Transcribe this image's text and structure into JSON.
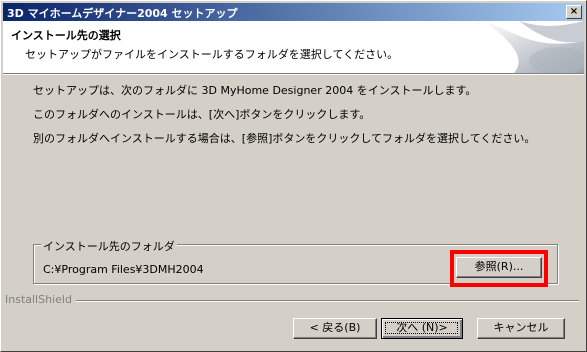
{
  "window": {
    "title": "3D マイホームデザイナー2004 セットアップ",
    "close_label": "×"
  },
  "header": {
    "title": "インストール先の選択",
    "subtitle": "セットアップがファイルをインストールするフォルダを選択してください。"
  },
  "body": {
    "line1": "セットアップは、次のフォルダに 3D MyHome Designer 2004 をインストールします。",
    "line2": "このフォルダへのインストールは、[次へ]ボタンをクリックします。",
    "line3": "別のフォルダへインストールする場合は、[参照]ボタンをクリックしてフォルダを選択してください。"
  },
  "destination": {
    "group_label": "インストール先のフォルダ",
    "path": "C:¥Program Files¥3DMH2004",
    "browse_label": "参照(R)..."
  },
  "footer": {
    "brand": "InstallShield",
    "back_label": "< 戻る(B)",
    "next_label": "次へ (N)>",
    "cancel_label": "キャンセル"
  },
  "colors": {
    "titlebar_start": "#0a246a",
    "titlebar_end": "#a6caf0",
    "highlight": "#ff0000",
    "dialog_bg": "#d4d0c8"
  }
}
